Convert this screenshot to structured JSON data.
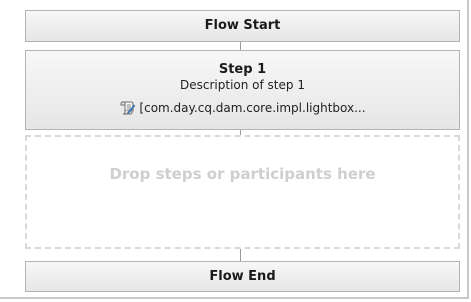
{
  "workflow": {
    "start": {
      "label": "Flow Start"
    },
    "steps": [
      {
        "title": "Step 1",
        "description": "Description of step 1",
        "implementation": "[com.day.cq.dam.core.impl.lightbox...",
        "icon": "script-icon"
      }
    ],
    "drop_zone": {
      "hint": "Drop steps or participants here"
    },
    "end": {
      "label": "Flow End"
    }
  },
  "colors": {
    "box_border": "#b3b3b3",
    "box_fill_top": "#f7f7f7",
    "box_fill_bottom": "#e6e6e6",
    "drop_border": "#d9d9d9",
    "drop_text": "#cfcfcf"
  }
}
